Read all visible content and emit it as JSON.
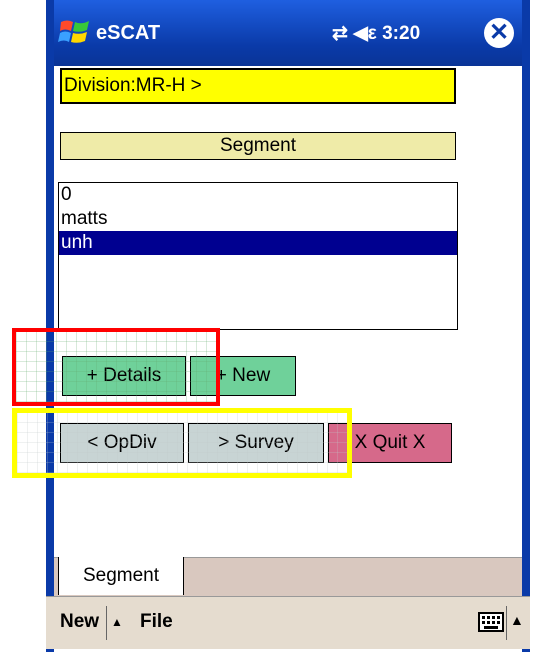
{
  "window": {
    "title": "eSCAT",
    "status": "⇄ ◀ε 3:20",
    "close_icon": "✕"
  },
  "division": {
    "label": "Division:MR-H >"
  },
  "segment_header": {
    "label": "Segment"
  },
  "list": {
    "items": [
      "0",
      "matts",
      "unh"
    ],
    "selected_index": 2
  },
  "buttons": {
    "details": "+ Details",
    "new": "+ New",
    "opdiv": "< OpDiv",
    "survey": "> Survey",
    "quit": "X Quit X"
  },
  "tabs": {
    "segment": "Segment"
  },
  "menu": {
    "new": "New",
    "file": "File",
    "up_arrow": "▲"
  },
  "colors": {
    "division_bg": "#ffff00",
    "segment_bg": "#efeba8",
    "selected_bg": "#000090",
    "green_button": "#6fd19a",
    "grey_button": "#c8d4d4",
    "quit_button": "#d6698a",
    "highlight_red": "#ff0000",
    "highlight_yellow": "#ffff00"
  }
}
